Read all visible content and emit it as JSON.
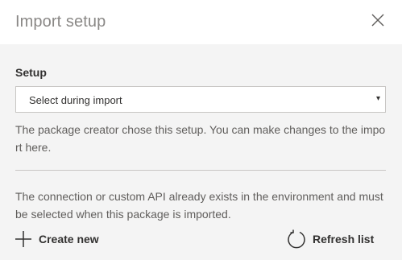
{
  "dialog": {
    "title": "Import setup",
    "close_icon": "close-icon"
  },
  "setup": {
    "label": "Setup",
    "select_value": "Select during import",
    "caret": "▾",
    "description": "The package creator chose this setup. You can make changes to the import here."
  },
  "connection": {
    "description": "The connection or custom API already exists in the environment and must be selected when this package is imported."
  },
  "actions": {
    "create_new": "Create new",
    "create_icon": "plus-icon",
    "refresh_list": "Refresh list",
    "refresh_icon": "refresh-icon"
  }
}
